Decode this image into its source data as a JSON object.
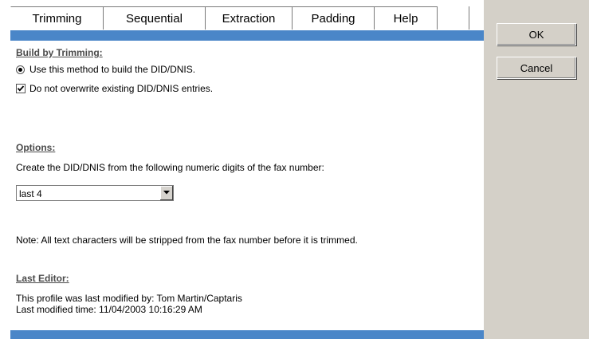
{
  "tabs": [
    {
      "label": "Trimming",
      "active": true
    },
    {
      "label": "Sequential",
      "active": false
    },
    {
      "label": "Extraction",
      "active": false
    },
    {
      "label": "Padding",
      "active": false
    },
    {
      "label": "Help",
      "active": false
    }
  ],
  "build": {
    "header": "Build by Trimming:",
    "radio_label": "Use this method to build the DID/DNIS.",
    "radio_selected": true,
    "checkbox_label": "Do not overwrite existing DID/DNIS entries.",
    "checkbox_checked": true
  },
  "options": {
    "header": "Options:",
    "instruction": "Create the DID/DNIS from the following numeric digits of the fax number:",
    "select_value": "last 4",
    "note": "Note: All text characters will be stripped from the fax number before it is trimmed."
  },
  "last_editor": {
    "header": "Last Editor:",
    "modified_by": "This profile was last modified by: Tom Martin/Captaris",
    "modified_time": "Last modified time: 11/04/2003 10:16:29 AM"
  },
  "buttons": {
    "ok": "OK",
    "cancel": "Cancel"
  },
  "colors": {
    "accent_bar": "#4a86c8",
    "panel": "#d4d0c8"
  }
}
